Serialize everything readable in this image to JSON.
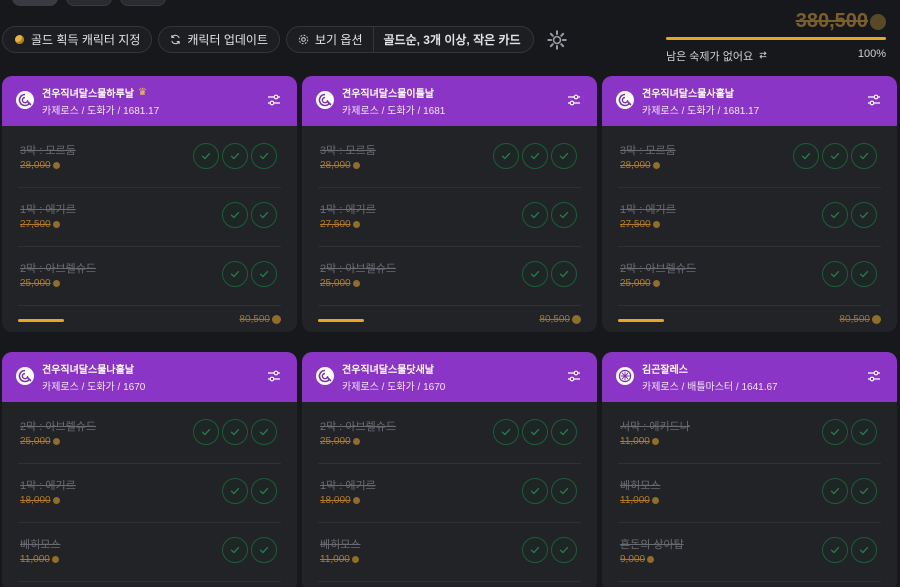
{
  "toolbar": {
    "gold_character_label": "골드 획득 캐릭터 지정",
    "update_label": "캐릭터 업데이트",
    "view_options_label": "보기 옵션",
    "view_options_value": "골드순, 3개 이상, 작은 카드"
  },
  "gold_panel": {
    "total": "380,500",
    "status": "남은 숙제가 없어요",
    "progress_percent": 100,
    "progress_label": "100%"
  },
  "cards": [
    {
      "name": "견우직녀달스물하루날",
      "crown": true,
      "sub": "카제로스 / 도화가 / 1681.17",
      "avatar": "artist",
      "rows": [
        {
          "title": "3막 : 모르둠",
          "gold": "28,000",
          "checks": 3
        },
        {
          "title": "1막 : 에기르",
          "gold": "27,500",
          "checks": 2
        },
        {
          "title": "2막 : 아브렐슈드",
          "gold": "25,000",
          "checks": 2
        }
      ],
      "progress": 1.0,
      "total": "80,500"
    },
    {
      "name": "견우직녀달스물이틀날",
      "crown": false,
      "sub": "카제로스 / 도화가 / 1681",
      "avatar": "artist",
      "rows": [
        {
          "title": "3막 : 모르둠",
          "gold": "28,000",
          "checks": 3
        },
        {
          "title": "1막 : 에기르",
          "gold": "27,500",
          "checks": 2
        },
        {
          "title": "2막 : 아브렐슈드",
          "gold": "25,000",
          "checks": 2
        }
      ],
      "progress": 1.0,
      "total": "80,500"
    },
    {
      "name": "견우직녀달스물사흘날",
      "crown": false,
      "sub": "카제로스 / 도화가 / 1681.17",
      "avatar": "artist",
      "rows": [
        {
          "title": "3막 : 모르둠",
          "gold": "28,000",
          "checks": 3
        },
        {
          "title": "1막 : 에기르",
          "gold": "27,500",
          "checks": 2
        },
        {
          "title": "2막 : 아브렐슈드",
          "gold": "25,000",
          "checks": 2
        }
      ],
      "progress": 1.0,
      "total": "80,500"
    },
    {
      "name": "견우직녀달스물나흘날",
      "crown": false,
      "sub": "카제로스 / 도화가 / 1670",
      "avatar": "artist",
      "rows": [
        {
          "title": "2막 : 아브렐슈드",
          "gold": "25,000",
          "checks": 3
        },
        {
          "title": "1막 : 에기르",
          "gold": "18,000",
          "checks": 2
        },
        {
          "title": "베히모스",
          "gold": "11,000",
          "checks": 2
        }
      ],
      "progress": 1.0,
      "total": ""
    },
    {
      "name": "견우직녀달스물닷새날",
      "crown": false,
      "sub": "카제로스 / 도화가 / 1670",
      "avatar": "artist",
      "rows": [
        {
          "title": "2막 : 아브렐슈드",
          "gold": "25,000",
          "checks": 3
        },
        {
          "title": "1막 : 에기르",
          "gold": "18,000",
          "checks": 2
        },
        {
          "title": "베히모스",
          "gold": "11,000",
          "checks": 2
        }
      ],
      "progress": 1.0,
      "total": ""
    },
    {
      "name": "김곤잘레스",
      "crown": false,
      "sub": "카제로스 / 배틀마스터 / 1641.67",
      "avatar": "battlemaster",
      "rows": [
        {
          "title": "서막 : 에키드나",
          "gold": "11,000",
          "checks": 2
        },
        {
          "title": "베히모스",
          "gold": "11,000",
          "checks": 2
        },
        {
          "title": "혼돈의 상아탑",
          "gold": "9,000",
          "checks": 2
        }
      ],
      "progress": 1.0,
      "total": ""
    }
  ]
}
